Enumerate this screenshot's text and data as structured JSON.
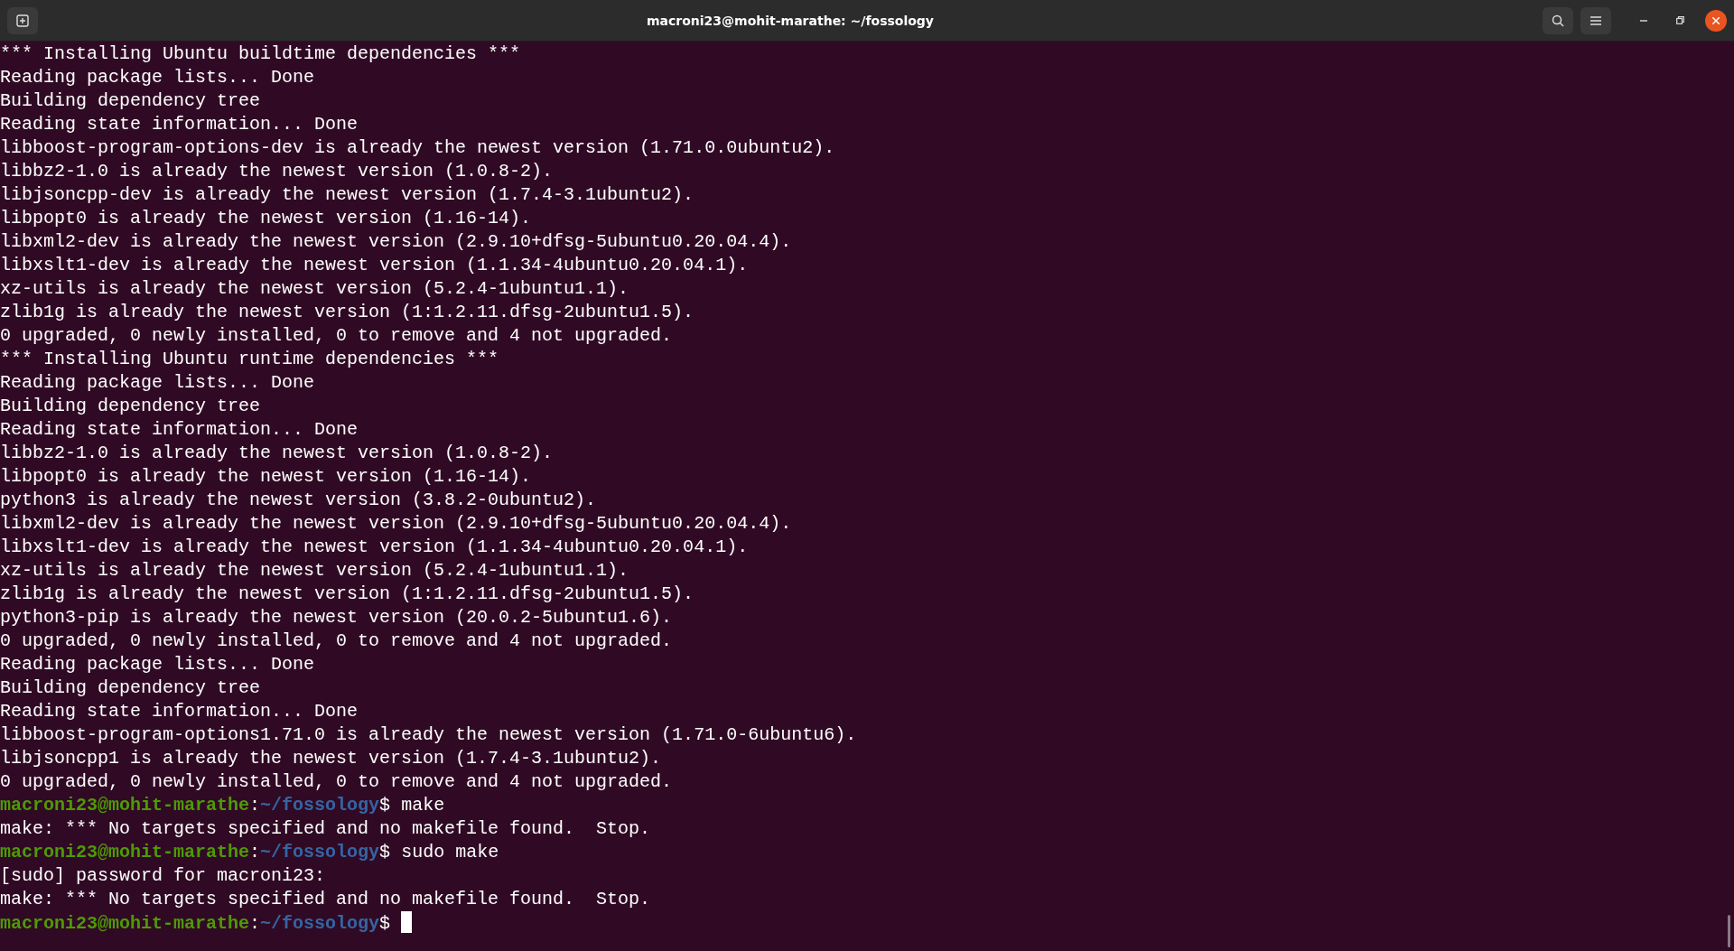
{
  "window": {
    "title": "macroni23@mohit-marathe: ~/fossology"
  },
  "lines": [
    {
      "kind": "output",
      "text": "*** Installing Ubuntu buildtime dependencies ***"
    },
    {
      "kind": "output",
      "text": "Reading package lists... Done"
    },
    {
      "kind": "output",
      "text": "Building dependency tree"
    },
    {
      "kind": "output",
      "text": "Reading state information... Done"
    },
    {
      "kind": "output",
      "text": "libboost-program-options-dev is already the newest version (1.71.0.0ubuntu2)."
    },
    {
      "kind": "output",
      "text": "libbz2-1.0 is already the newest version (1.0.8-2)."
    },
    {
      "kind": "output",
      "text": "libjsoncpp-dev is already the newest version (1.7.4-3.1ubuntu2)."
    },
    {
      "kind": "output",
      "text": "libpopt0 is already the newest version (1.16-14)."
    },
    {
      "kind": "output",
      "text": "libxml2-dev is already the newest version (2.9.10+dfsg-5ubuntu0.20.04.4)."
    },
    {
      "kind": "output",
      "text": "libxslt1-dev is already the newest version (1.1.34-4ubuntu0.20.04.1)."
    },
    {
      "kind": "output",
      "text": "xz-utils is already the newest version (5.2.4-1ubuntu1.1)."
    },
    {
      "kind": "output",
      "text": "zlib1g is already the newest version (1:1.2.11.dfsg-2ubuntu1.5)."
    },
    {
      "kind": "output",
      "text": "0 upgraded, 0 newly installed, 0 to remove and 4 not upgraded."
    },
    {
      "kind": "output",
      "text": "*** Installing Ubuntu runtime dependencies ***"
    },
    {
      "kind": "output",
      "text": "Reading package lists... Done"
    },
    {
      "kind": "output",
      "text": "Building dependency tree"
    },
    {
      "kind": "output",
      "text": "Reading state information... Done"
    },
    {
      "kind": "output",
      "text": "libbz2-1.0 is already the newest version (1.0.8-2)."
    },
    {
      "kind": "output",
      "text": "libpopt0 is already the newest version (1.16-14)."
    },
    {
      "kind": "output",
      "text": "python3 is already the newest version (3.8.2-0ubuntu2)."
    },
    {
      "kind": "output",
      "text": "libxml2-dev is already the newest version (2.9.10+dfsg-5ubuntu0.20.04.4)."
    },
    {
      "kind": "output",
      "text": "libxslt1-dev is already the newest version (1.1.34-4ubuntu0.20.04.1)."
    },
    {
      "kind": "output",
      "text": "xz-utils is already the newest version (5.2.4-1ubuntu1.1)."
    },
    {
      "kind": "output",
      "text": "zlib1g is already the newest version (1:1.2.11.dfsg-2ubuntu1.5)."
    },
    {
      "kind": "output",
      "text": "python3-pip is already the newest version (20.0.2-5ubuntu1.6)."
    },
    {
      "kind": "output",
      "text": "0 upgraded, 0 newly installed, 0 to remove and 4 not upgraded."
    },
    {
      "kind": "output",
      "text": "Reading package lists... Done"
    },
    {
      "kind": "output",
      "text": "Building dependency tree"
    },
    {
      "kind": "output",
      "text": "Reading state information... Done"
    },
    {
      "kind": "output",
      "text": "libboost-program-options1.71.0 is already the newest version (1.71.0-6ubuntu6)."
    },
    {
      "kind": "output",
      "text": "libjsoncpp1 is already the newest version (1.7.4-3.1ubuntu2)."
    },
    {
      "kind": "output",
      "text": "0 upgraded, 0 newly installed, 0 to remove and 4 not upgraded."
    },
    {
      "kind": "prompt",
      "user_host": "macroni23@mohit-marathe",
      "separator": ":",
      "path": "~/fossology",
      "symbol": "$",
      "command": "make",
      "cursor": false
    },
    {
      "kind": "output",
      "text": "make: *** No targets specified and no makefile found.  Stop."
    },
    {
      "kind": "prompt",
      "user_host": "macroni23@mohit-marathe",
      "separator": ":",
      "path": "~/fossology",
      "symbol": "$",
      "command": "sudo make",
      "cursor": false
    },
    {
      "kind": "output",
      "text": "[sudo] password for macroni23:"
    },
    {
      "kind": "output",
      "text": "make: *** No targets specified and no makefile found.  Stop."
    },
    {
      "kind": "prompt",
      "user_host": "macroni23@mohit-marathe",
      "separator": ":",
      "path": "~/fossology",
      "symbol": "$",
      "cursor": true
    }
  ]
}
